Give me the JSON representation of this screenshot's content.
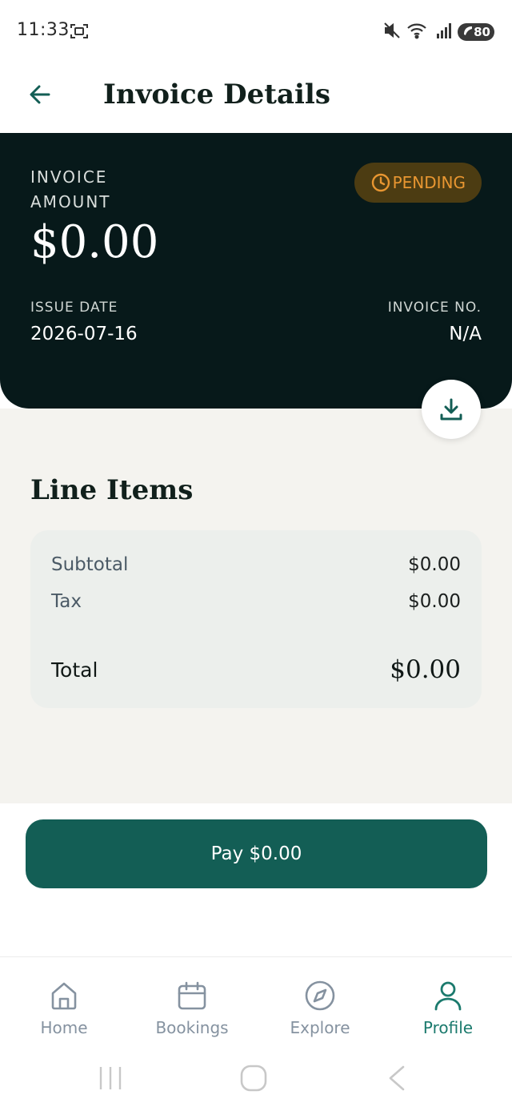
{
  "status_bar": {
    "time": "11:33",
    "battery": "80"
  },
  "header": {
    "title": "Invoice Details"
  },
  "invoice": {
    "amount_label": "INVOICE AMOUNT",
    "amount": "$0.00",
    "status": "PENDING",
    "issue_date_label": "ISSUE DATE",
    "issue_date": "2026-07-16",
    "invoice_no_label": "INVOICE NO.",
    "invoice_no": "N/A"
  },
  "line_items": {
    "title": "Line Items",
    "subtotal_label": "Subtotal",
    "subtotal": "$0.00",
    "tax_label": "Tax",
    "tax": "$0.00",
    "total_label": "Total",
    "total": "$0.00"
  },
  "pay_button": {
    "label": "Pay $0.00"
  },
  "bottom_nav": {
    "items": [
      {
        "label": "Home",
        "icon": "home-icon"
      },
      {
        "label": "Bookings",
        "icon": "calendar-icon"
      },
      {
        "label": "Explore",
        "icon": "compass-icon"
      },
      {
        "label": "Profile",
        "icon": "person-icon",
        "active": true
      }
    ]
  },
  "colors": {
    "primary": "#135e55",
    "hero_bg": "#07191a",
    "pending_text": "#e89631",
    "pending_bg": "#4c3c12",
    "active_nav": "#1b7a6d",
    "inactive_nav": "#8592a0"
  }
}
